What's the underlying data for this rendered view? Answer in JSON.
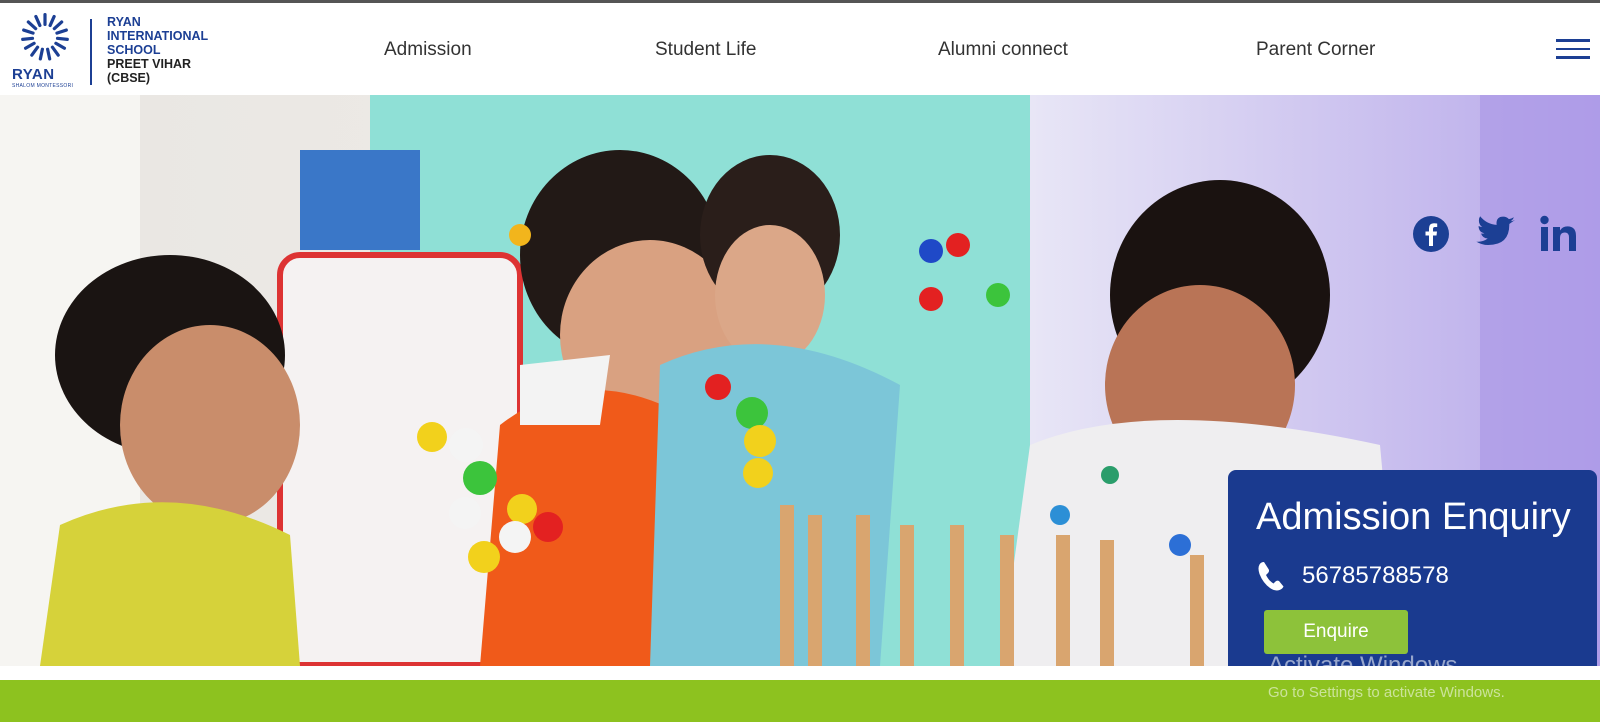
{
  "logo": {
    "brand": "RYAN",
    "brand_sub": "SHALOM MONTESSORI",
    "line1": "RYAN",
    "line2": "INTERNATIONAL",
    "line3": "SCHOOL",
    "line4": "PREET VIHAR",
    "line5": "(CBSE)"
  },
  "nav": {
    "items": [
      {
        "label": "Admission"
      },
      {
        "label": "Student Life"
      },
      {
        "label": "Alumni connect"
      },
      {
        "label": "Parent Corner"
      }
    ],
    "menu_icon": "hamburger-menu-icon"
  },
  "social": [
    {
      "icon": "facebook-icon"
    },
    {
      "icon": "twitter-icon"
    },
    {
      "icon": "linkedin-icon"
    }
  ],
  "enquiry": {
    "title": "Admission Enquiry",
    "phone": "56785788578",
    "button": "Enquire"
  },
  "watermark": {
    "line1": "Activate Windows",
    "line2": "Go to Settings to activate Windows."
  },
  "colors": {
    "brand_blue": "#1c3f94",
    "enquiry_bg": "#1a3a8f",
    "accent_green": "#8dc21f"
  }
}
